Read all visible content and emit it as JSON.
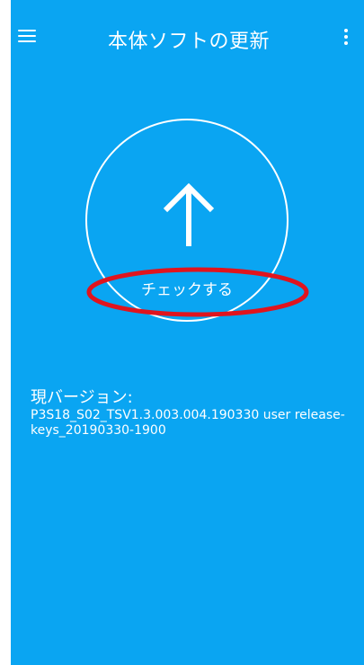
{
  "header": {
    "title": "本体ソフトの更新",
    "menu_icon": "hamburger-menu-icon",
    "more_icon": "more-vert-icon"
  },
  "check": {
    "label": "チェックする",
    "icon": "arrow-up-icon"
  },
  "version": {
    "label": "現バージョン:",
    "value": " P3S18_S02_TSV1.3.003.004.190330 user release-keys_20190330-1900"
  },
  "colors": {
    "background": "#0aa5f2",
    "foreground": "#ffffff",
    "annotation": "#e0141e"
  }
}
